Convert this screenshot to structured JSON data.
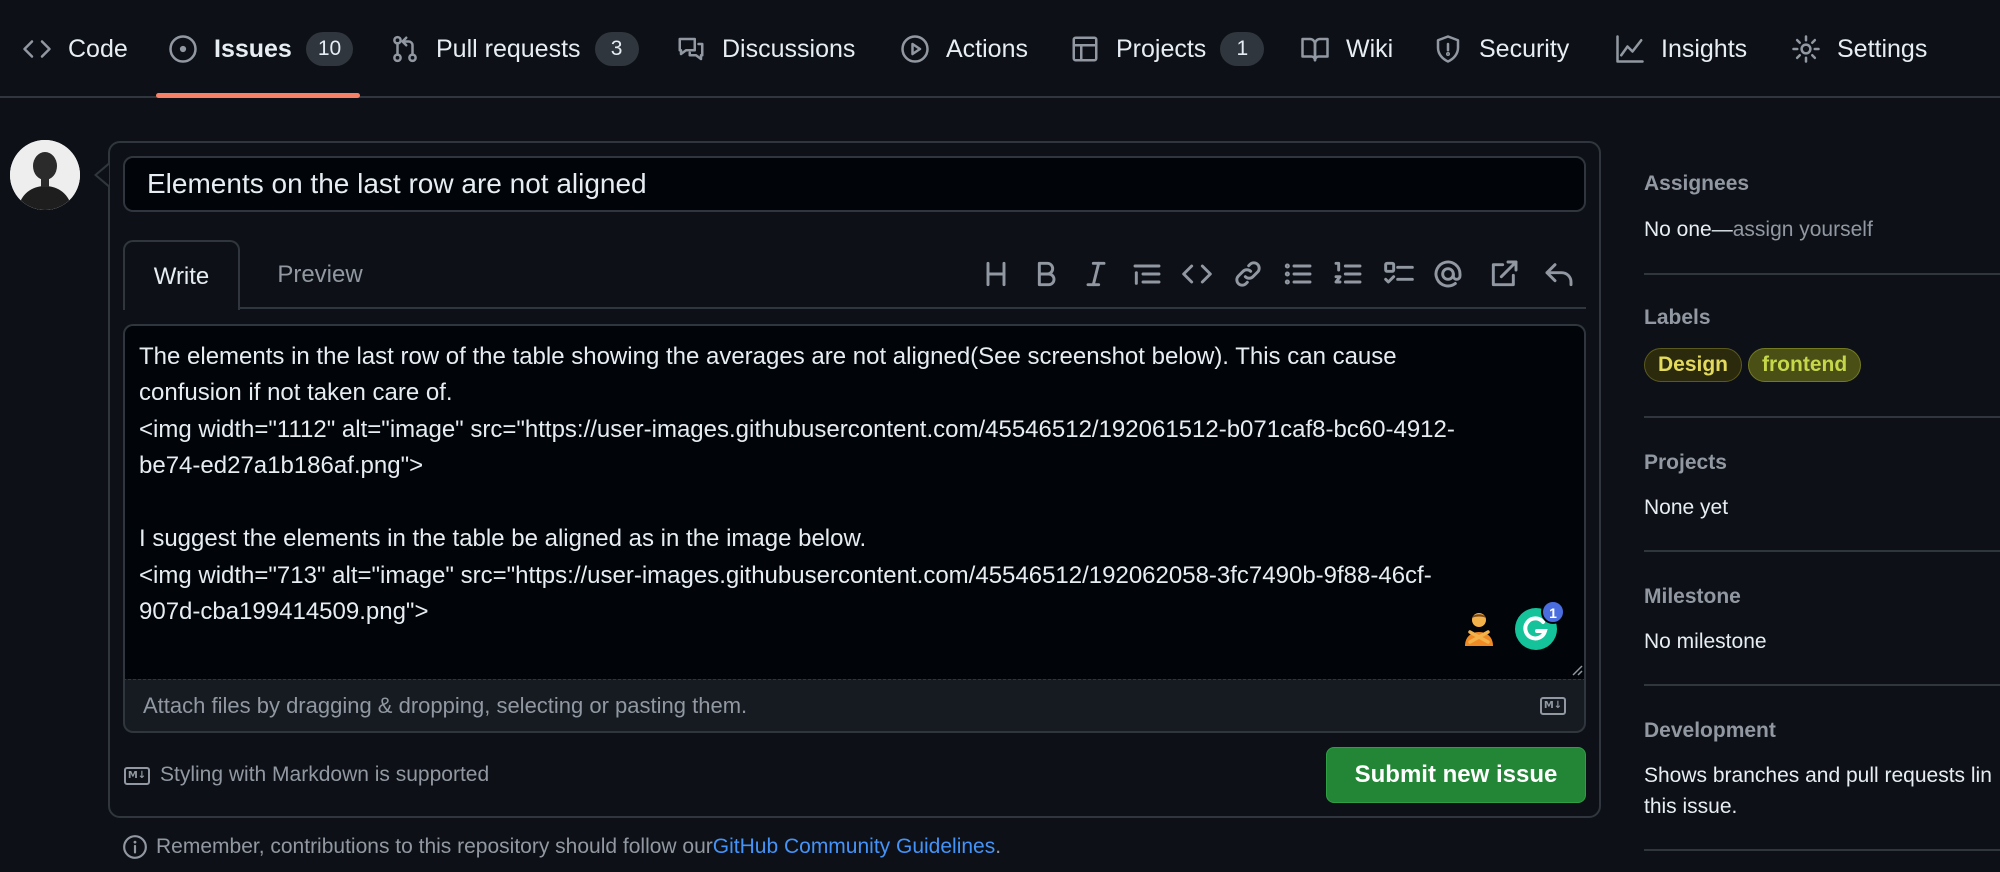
{
  "nav": {
    "code": "Code",
    "issues": "Issues",
    "issues_count": "10",
    "pulls": "Pull requests",
    "pulls_count": "3",
    "discussions": "Discussions",
    "actions": "Actions",
    "projects": "Projects",
    "projects_count": "1",
    "wiki": "Wiki",
    "security": "Security",
    "insights": "Insights",
    "settings": "Settings"
  },
  "issue": {
    "title_value": "Elements on the last row are not aligned",
    "tab_write": "Write",
    "tab_preview": "Preview",
    "body_lines": [
      "The elements in the last row of the table showing the averages are not aligned(See screenshot below). This can cause",
      "confusion if not taken care of.",
      "<img width=\"1112\" alt=\"image\" src=\"https://user-images.githubusercontent.com/45546512/192061512-b071caf8-bc60-4912-",
      "be74-ed27a1b186af.png\">",
      "",
      "I suggest the elements in the table be aligned as in the image below.",
      "<img width=\"713\" alt=\"image\" src=\"https://user-images.githubusercontent.com/45546512/192062058-3fc7490b-9f88-46cf-",
      "907d-cba199414509.png\">"
    ],
    "attach_text": "Attach files by dragging & dropping, selecting or pasting them.",
    "markdown_badge": "M↓",
    "styling_text": "Styling with Markdown is supported",
    "submit_label": "Submit new issue",
    "grammarly_count": "1"
  },
  "footer": {
    "remember_prefix": "Remember, contributions to this repository should follow our ",
    "guidelines_link": "GitHub Community Guidelines",
    "remember_suffix": "."
  },
  "sidebar": {
    "assignees_heading": "Assignees",
    "assignees_value": "No one—",
    "assign_yourself": "assign yourself",
    "labels_heading": "Labels",
    "labels": [
      "Design",
      "frontend"
    ],
    "projects_heading": "Projects",
    "projects_value": "None yet",
    "milestone_heading": "Milestone",
    "milestone_value": "No milestone",
    "development_heading": "Development",
    "development_line1": "Shows branches and pull requests lin",
    "development_line2": "this issue."
  },
  "colors": {
    "background": "#0d1117",
    "accent_underline": "#f78166",
    "submit_green": "#238636",
    "link_blue": "#4493f8"
  }
}
